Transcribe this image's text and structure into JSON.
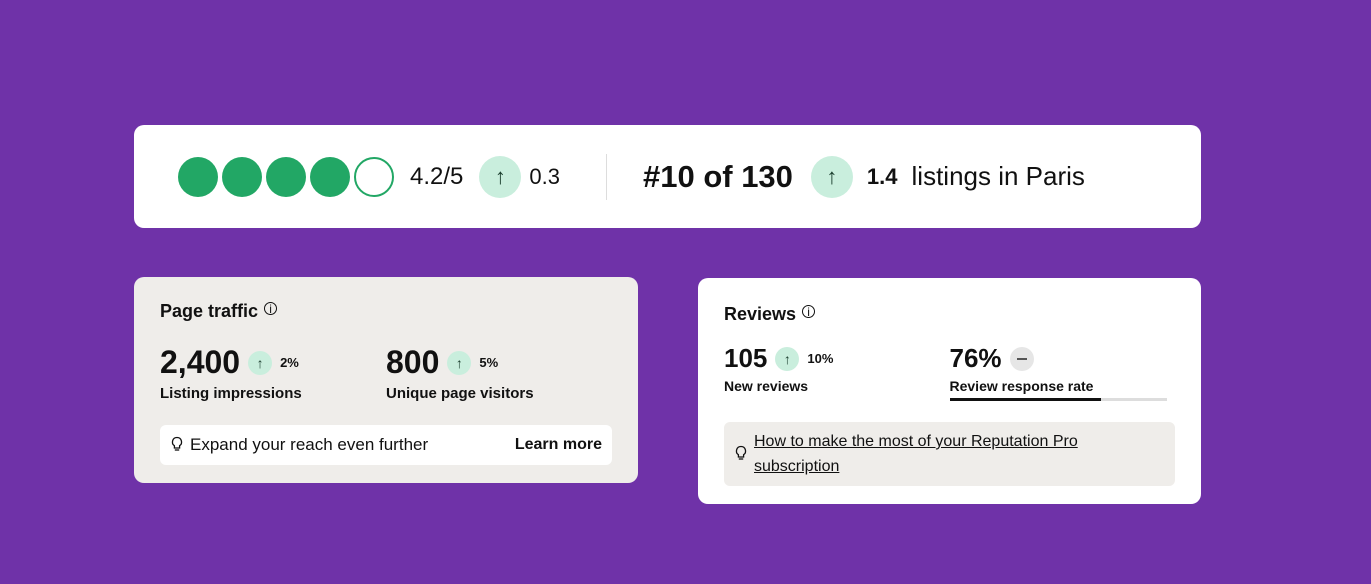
{
  "rating": {
    "bubbles_filled": 4,
    "bubbles_total": 5,
    "score_text": "4.2/5",
    "delta_arrow": "↑",
    "delta": "0.3"
  },
  "ranking": {
    "rank_text": "#10 of 130",
    "delta_arrow": "↑",
    "delta": "1.4",
    "suffix": "listings in Paris"
  },
  "traffic": {
    "title": "Page traffic",
    "info_glyph": "i",
    "metrics": [
      {
        "value": "2,400",
        "arrow": "↑",
        "delta": "2%",
        "label": "Listing impressions"
      },
      {
        "value": "800",
        "arrow": "↑",
        "delta": "5%",
        "label": "Unique page visitors"
      }
    ],
    "tip_icon": "lightbulb-icon",
    "tip_text": "Expand your reach even further",
    "tip_link": "Learn more"
  },
  "reviews": {
    "title": "Reviews",
    "info_glyph": "i",
    "new_reviews": {
      "value": "105",
      "arrow": "↑",
      "delta": "10%",
      "label": "New reviews"
    },
    "response_rate": {
      "value": "76%",
      "label": "Review response rate",
      "progress_fraction": 0.7
    },
    "tip_icon": "lightbulb-icon",
    "tip_link": "How to make the most of your Reputation Pro subscription"
  },
  "colors": {
    "background": "#6f32a8",
    "bubble_green": "#22a765",
    "badge_green": "#c9eedd"
  }
}
